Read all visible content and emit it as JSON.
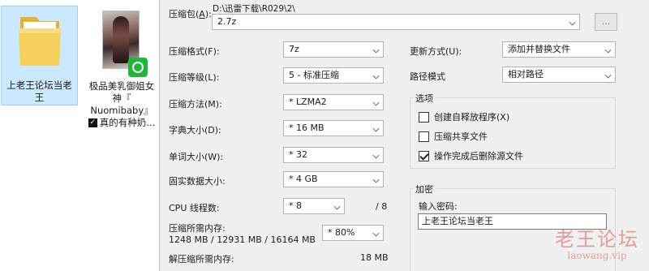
{
  "desktop": {
    "folder": {
      "label": "上老王论坛当老王",
      "icon": "folder-icon"
    },
    "video": {
      "label_lines": [
        "极品美乳御姐女",
        "神『",
        "Nuomibaby』"
      ],
      "last_line": "真的有种奶...",
      "badge_icon": "app-badge-icon"
    }
  },
  "dialog": {
    "archive_label_prefix": "压缩包(",
    "archive_label_key": "A",
    "archive_label_suffix": "):",
    "archive_path": "D:\\迅雷下载\\R029\\2\\",
    "archive_name": "2.7z",
    "browse_label": "...",
    "left": {
      "format_label": "压缩格式(F):",
      "format_value": "7z",
      "level_label": "压缩等级(L):",
      "level_value": "5 - 标准压缩",
      "method_label": "压缩方法(M):",
      "method_value": "*  LZMA2",
      "dict_label": "字典大小(D):",
      "dict_value": "*  16 MB",
      "word_label": "单词大小(W):",
      "word_value": "*  32",
      "solid_label": "固实数据大小:",
      "solid_value": "*  4 GB",
      "cpu_label": "CPU 线程数:",
      "cpu_value": "*  8",
      "cpu_max": "/ 8",
      "mem_label": "压缩所需内存:",
      "mem_detail": "1248 MB / 12931 MB / 16164 MB",
      "mem_value": "*  80%",
      "decomp_label": "解压缩所需内存:",
      "decomp_value": "18 MB"
    },
    "right": {
      "update_label": "更新方式(U):",
      "update_value": "添加并替换文件",
      "path_label": "路径模式",
      "path_value": "相对路径",
      "options_title": "选项",
      "opt_sfx": "创建自释放程序(X)",
      "opt_shared": "压缩共享文件",
      "opt_delete": "操作完成后删除源文件",
      "encrypt_title": "加密",
      "password_label": "输入密码:",
      "password_value": "上老王论坛当老王"
    }
  },
  "watermark": {
    "main": "老王论坛",
    "sub": "laowang.vip"
  }
}
